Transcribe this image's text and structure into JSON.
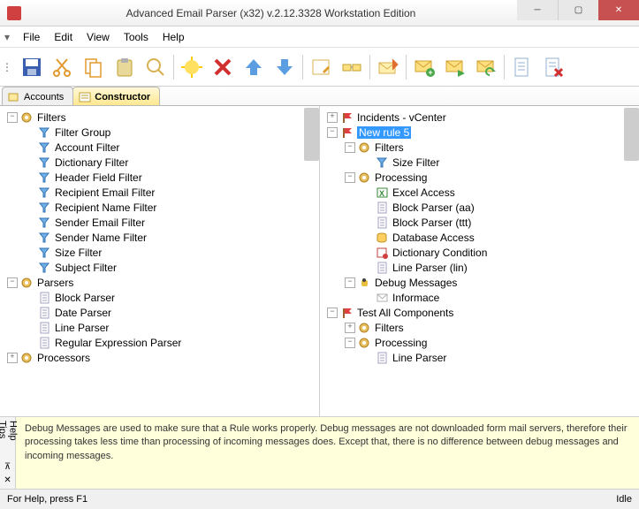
{
  "window": {
    "title": "Advanced Email Parser (x32) v.2.12.3328 Workstation Edition"
  },
  "menu": [
    "File",
    "Edit",
    "View",
    "Tools",
    "Help"
  ],
  "tabs": [
    {
      "label": "Accounts",
      "active": false
    },
    {
      "label": "Constructor",
      "active": true
    }
  ],
  "left_tree": [
    {
      "label": "Filters",
      "expander": "-",
      "indent": 0,
      "icon": "gear"
    },
    {
      "label": "Filter Group",
      "expander": "",
      "indent": 1,
      "icon": "funnel"
    },
    {
      "label": "Account Filter",
      "expander": "",
      "indent": 1,
      "icon": "funnel"
    },
    {
      "label": "Dictionary Filter",
      "expander": "",
      "indent": 1,
      "icon": "funnel"
    },
    {
      "label": "Header Field Filter",
      "expander": "",
      "indent": 1,
      "icon": "funnel"
    },
    {
      "label": "Recipient Email Filter",
      "expander": "",
      "indent": 1,
      "icon": "funnel"
    },
    {
      "label": "Recipient Name Filter",
      "expander": "",
      "indent": 1,
      "icon": "funnel"
    },
    {
      "label": "Sender Email Filter",
      "expander": "",
      "indent": 1,
      "icon": "funnel"
    },
    {
      "label": "Sender Name Filter",
      "expander": "",
      "indent": 1,
      "icon": "funnel"
    },
    {
      "label": "Size Filter",
      "expander": "",
      "indent": 1,
      "icon": "funnel"
    },
    {
      "label": "Subject Filter",
      "expander": "",
      "indent": 1,
      "icon": "funnel"
    },
    {
      "label": "Parsers",
      "expander": "-",
      "indent": 0,
      "icon": "gear"
    },
    {
      "label": "Block Parser",
      "expander": "",
      "indent": 1,
      "icon": "doc"
    },
    {
      "label": "Date Parser",
      "expander": "",
      "indent": 1,
      "icon": "doc"
    },
    {
      "label": "Line Parser",
      "expander": "",
      "indent": 1,
      "icon": "doc"
    },
    {
      "label": "Regular Expression Parser",
      "expander": "",
      "indent": 1,
      "icon": "doc"
    },
    {
      "label": "Processors",
      "expander": "+",
      "indent": 0,
      "icon": "gear"
    }
  ],
  "right_tree": [
    {
      "label": "Incidents - vCenter",
      "expander": "+",
      "indent": 0,
      "icon": "flag"
    },
    {
      "label": "New rule 5",
      "expander": "-",
      "indent": 0,
      "icon": "flag",
      "selected": true
    },
    {
      "label": "Filters",
      "expander": "-",
      "indent": 1,
      "icon": "gear"
    },
    {
      "label": "Size Filter",
      "expander": "",
      "indent": 2,
      "icon": "funnel"
    },
    {
      "label": "Processing",
      "expander": "-",
      "indent": 1,
      "icon": "gear"
    },
    {
      "label": "Excel Access",
      "expander": "",
      "indent": 2,
      "icon": "excel"
    },
    {
      "label": "Block Parser (aa)",
      "expander": "",
      "indent": 2,
      "icon": "doc"
    },
    {
      "label": "Block Parser (ttt)",
      "expander": "",
      "indent": 2,
      "icon": "doc"
    },
    {
      "label": "Database Access",
      "expander": "",
      "indent": 2,
      "icon": "db"
    },
    {
      "label": "Dictionary Condition",
      "expander": "",
      "indent": 2,
      "icon": "cond"
    },
    {
      "label": "Line Parser (lin)",
      "expander": "",
      "indent": 2,
      "icon": "doc"
    },
    {
      "label": "Debug Messages",
      "expander": "-",
      "indent": 1,
      "icon": "bug"
    },
    {
      "label": "Informace",
      "expander": "",
      "indent": 2,
      "icon": "mail"
    },
    {
      "label": "Test All Components",
      "expander": "-",
      "indent": 0,
      "icon": "flag"
    },
    {
      "label": "Filters",
      "expander": "+",
      "indent": 1,
      "icon": "gear"
    },
    {
      "label": "Processing",
      "expander": "-",
      "indent": 1,
      "icon": "gear"
    },
    {
      "label": "Line Parser",
      "expander": "",
      "indent": 2,
      "icon": "doc"
    }
  ],
  "helptips": {
    "label": "Help Tips",
    "text": "Debug Messages are used to make sure that a Rule works properly. Debug messages are not downloaded form mail servers, therefore their processing takes less time than processing of incoming messages does. Except that, there is no difference between debug messages and incoming messages."
  },
  "statusbar": {
    "left": "For Help, press F1",
    "right": "Idle"
  },
  "toolbar_icons": [
    "save",
    "cut",
    "copy",
    "paste",
    "search",
    "new",
    "delete",
    "up",
    "down",
    "edit",
    "connect",
    "receive",
    "send-new",
    "send-reply",
    "send-all",
    "docview",
    "docdel"
  ]
}
